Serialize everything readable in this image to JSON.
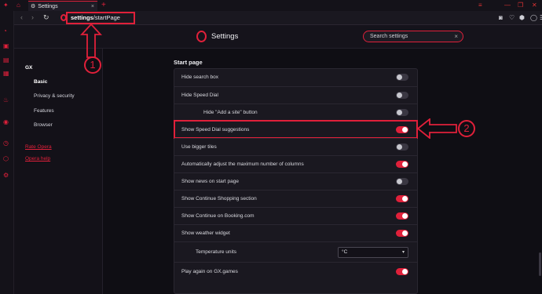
{
  "tab": {
    "title": "Settings",
    "close": "×",
    "new_tab": "+"
  },
  "nav": {
    "back": "‹",
    "forward": "›",
    "reload": "↻"
  },
  "address": {
    "bold": "settings",
    "rest": "/startPage"
  },
  "header": {
    "title": "Settings",
    "search_placeholder": "Search settings",
    "search_clear": "×"
  },
  "sidebar": {
    "items": [
      {
        "label": "GX"
      },
      {
        "label": "Basic"
      },
      {
        "label": "Privacy & security"
      },
      {
        "label": "Features"
      },
      {
        "label": "Browser"
      }
    ],
    "links": [
      {
        "label": "Rate Opera"
      },
      {
        "label": "Opera help"
      }
    ]
  },
  "section": {
    "title": "Start page"
  },
  "rows": [
    {
      "label": "Hide search box",
      "on": false
    },
    {
      "label": "Hide Speed Dial",
      "on": false
    },
    {
      "label": "Hide \"Add a site\" button",
      "on": false
    },
    {
      "label": "Show Speed Dial suggestions",
      "on": true
    },
    {
      "label": "Use bigger tiles",
      "on": false
    },
    {
      "label": "Automatically adjust the maximum number of columns",
      "on": true
    },
    {
      "label": "Show news on start page",
      "on": false
    },
    {
      "label": "Show Continue Shopping section",
      "on": true
    },
    {
      "label": "Show Continue on Booking.com",
      "on": true
    },
    {
      "label": "Show weather widget",
      "on": true
    },
    {
      "label": "Temperature units",
      "value": "°C"
    },
    {
      "label": "Play again on GX.games",
      "on": true
    }
  ],
  "annotations": {
    "one": "1",
    "two": "2"
  },
  "colors": {
    "accent": "#e0203a",
    "background": "#0f0e14",
    "card": "#1a1820"
  },
  "icons": [
    "gx-icon",
    "opera-logo-icon",
    "gear-icon",
    "camera-icon",
    "heart-icon",
    "cube-icon",
    "user-icon",
    "menu-icon"
  ]
}
